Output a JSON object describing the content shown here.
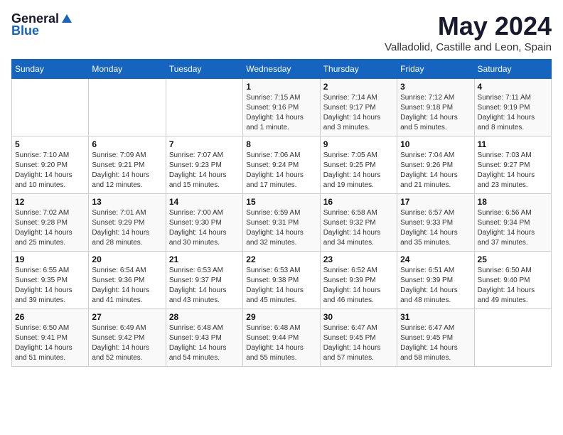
{
  "logo": {
    "general": "General",
    "blue": "Blue"
  },
  "title": "May 2024",
  "subtitle": "Valladolid, Castille and Leon, Spain",
  "days_of_week": [
    "Sunday",
    "Monday",
    "Tuesday",
    "Wednesday",
    "Thursday",
    "Friday",
    "Saturday"
  ],
  "weeks": [
    [
      {
        "day": "",
        "info": ""
      },
      {
        "day": "",
        "info": ""
      },
      {
        "day": "",
        "info": ""
      },
      {
        "day": "1",
        "info": "Sunrise: 7:15 AM\nSunset: 9:16 PM\nDaylight: 14 hours\nand 1 minute."
      },
      {
        "day": "2",
        "info": "Sunrise: 7:14 AM\nSunset: 9:17 PM\nDaylight: 14 hours\nand 3 minutes."
      },
      {
        "day": "3",
        "info": "Sunrise: 7:12 AM\nSunset: 9:18 PM\nDaylight: 14 hours\nand 5 minutes."
      },
      {
        "day": "4",
        "info": "Sunrise: 7:11 AM\nSunset: 9:19 PM\nDaylight: 14 hours\nand 8 minutes."
      }
    ],
    [
      {
        "day": "5",
        "info": "Sunrise: 7:10 AM\nSunset: 9:20 PM\nDaylight: 14 hours\nand 10 minutes."
      },
      {
        "day": "6",
        "info": "Sunrise: 7:09 AM\nSunset: 9:21 PM\nDaylight: 14 hours\nand 12 minutes."
      },
      {
        "day": "7",
        "info": "Sunrise: 7:07 AM\nSunset: 9:23 PM\nDaylight: 14 hours\nand 15 minutes."
      },
      {
        "day": "8",
        "info": "Sunrise: 7:06 AM\nSunset: 9:24 PM\nDaylight: 14 hours\nand 17 minutes."
      },
      {
        "day": "9",
        "info": "Sunrise: 7:05 AM\nSunset: 9:25 PM\nDaylight: 14 hours\nand 19 minutes."
      },
      {
        "day": "10",
        "info": "Sunrise: 7:04 AM\nSunset: 9:26 PM\nDaylight: 14 hours\nand 21 minutes."
      },
      {
        "day": "11",
        "info": "Sunrise: 7:03 AM\nSunset: 9:27 PM\nDaylight: 14 hours\nand 23 minutes."
      }
    ],
    [
      {
        "day": "12",
        "info": "Sunrise: 7:02 AM\nSunset: 9:28 PM\nDaylight: 14 hours\nand 25 minutes."
      },
      {
        "day": "13",
        "info": "Sunrise: 7:01 AM\nSunset: 9:29 PM\nDaylight: 14 hours\nand 28 minutes."
      },
      {
        "day": "14",
        "info": "Sunrise: 7:00 AM\nSunset: 9:30 PM\nDaylight: 14 hours\nand 30 minutes."
      },
      {
        "day": "15",
        "info": "Sunrise: 6:59 AM\nSunset: 9:31 PM\nDaylight: 14 hours\nand 32 minutes."
      },
      {
        "day": "16",
        "info": "Sunrise: 6:58 AM\nSunset: 9:32 PM\nDaylight: 14 hours\nand 34 minutes."
      },
      {
        "day": "17",
        "info": "Sunrise: 6:57 AM\nSunset: 9:33 PM\nDaylight: 14 hours\nand 35 minutes."
      },
      {
        "day": "18",
        "info": "Sunrise: 6:56 AM\nSunset: 9:34 PM\nDaylight: 14 hours\nand 37 minutes."
      }
    ],
    [
      {
        "day": "19",
        "info": "Sunrise: 6:55 AM\nSunset: 9:35 PM\nDaylight: 14 hours\nand 39 minutes."
      },
      {
        "day": "20",
        "info": "Sunrise: 6:54 AM\nSunset: 9:36 PM\nDaylight: 14 hours\nand 41 minutes."
      },
      {
        "day": "21",
        "info": "Sunrise: 6:53 AM\nSunset: 9:37 PM\nDaylight: 14 hours\nand 43 minutes."
      },
      {
        "day": "22",
        "info": "Sunrise: 6:53 AM\nSunset: 9:38 PM\nDaylight: 14 hours\nand 45 minutes."
      },
      {
        "day": "23",
        "info": "Sunrise: 6:52 AM\nSunset: 9:39 PM\nDaylight: 14 hours\nand 46 minutes."
      },
      {
        "day": "24",
        "info": "Sunrise: 6:51 AM\nSunset: 9:39 PM\nDaylight: 14 hours\nand 48 minutes."
      },
      {
        "day": "25",
        "info": "Sunrise: 6:50 AM\nSunset: 9:40 PM\nDaylight: 14 hours\nand 49 minutes."
      }
    ],
    [
      {
        "day": "26",
        "info": "Sunrise: 6:50 AM\nSunset: 9:41 PM\nDaylight: 14 hours\nand 51 minutes."
      },
      {
        "day": "27",
        "info": "Sunrise: 6:49 AM\nSunset: 9:42 PM\nDaylight: 14 hours\nand 52 minutes."
      },
      {
        "day": "28",
        "info": "Sunrise: 6:48 AM\nSunset: 9:43 PM\nDaylight: 14 hours\nand 54 minutes."
      },
      {
        "day": "29",
        "info": "Sunrise: 6:48 AM\nSunset: 9:44 PM\nDaylight: 14 hours\nand 55 minutes."
      },
      {
        "day": "30",
        "info": "Sunrise: 6:47 AM\nSunset: 9:45 PM\nDaylight: 14 hours\nand 57 minutes."
      },
      {
        "day": "31",
        "info": "Sunrise: 6:47 AM\nSunset: 9:45 PM\nDaylight: 14 hours\nand 58 minutes."
      },
      {
        "day": "",
        "info": ""
      }
    ]
  ]
}
